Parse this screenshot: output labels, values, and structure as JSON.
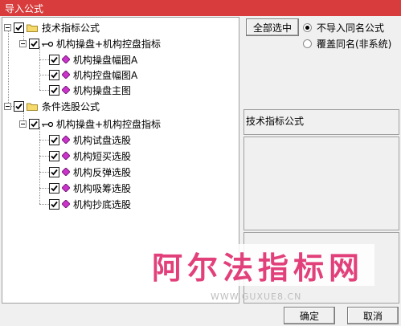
{
  "window": {
    "title": "导入公式"
  },
  "tree": {
    "groups": [
      {
        "label": "技术指标公式",
        "sub_label": "机构操盘+机构控盘指标",
        "items": [
          "机构操盘幅图A",
          "机构控盘幅图A",
          "机构操盘主图"
        ]
      },
      {
        "label": "条件选股公式",
        "sub_label": "机构操盘+机构控盘指标",
        "items": [
          "机构试盘选股",
          "机构短买选股",
          "机构反弹选股",
          "机构吸筹选股",
          "机构抄底选股"
        ]
      }
    ]
  },
  "right": {
    "select_all": "全部选中",
    "radio_skip": "不导入同名公式",
    "radio_overwrite": "覆盖同名(非系统)",
    "selected_radio": "radio_skip",
    "info_label": "技术指标公式"
  },
  "buttons": {
    "ok": "确定",
    "cancel": "取消"
  },
  "watermark": {
    "text": "阿尔法指标网",
    "url": "WWW.GUXUE8.CN"
  },
  "colors": {
    "titlebar": "#d83c3c",
    "watermark": "#e2407a",
    "gem": "#cc33cc",
    "folder": "#f5d96b"
  }
}
